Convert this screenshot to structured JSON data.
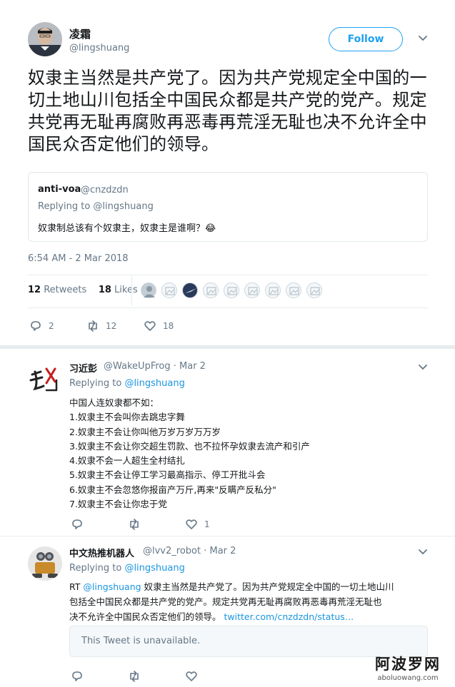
{
  "main_tweet": {
    "author_name": "凌霜",
    "author_handle": "@lingshuang",
    "follow_label": "Follow",
    "text": "奴隶主当然是共产党了。因为共产党规定全中国的一切土地山川包括全中国民众都是共产党的党产。规定共党再无耻再腐败再恶毒再荒淫无耻也决不允许全中国民众否定他们的领导。",
    "quote": {
      "name": "anti-voa",
      "handle": "@cnzdzdn",
      "replying": "Replying to @lingshuang",
      "text": "奴隶制总该有个奴隶主，奴隶主是谁啊？😂"
    },
    "timestamp": "6:54 AM - 2 Mar 2018",
    "retweets_count": "12",
    "retweets_label": "Retweets",
    "likes_count": "18",
    "likes_label": "Likes",
    "reply_count": "2",
    "retweet_count": "12",
    "like_count": "18"
  },
  "replies": [
    {
      "name": "习近彭",
      "handle_date": "@WakeUpFrog · Mar 2",
      "replying_prefix": "Replying to ",
      "replying_handle": "@lingshuang",
      "lines": [
        "中国人连奴隶都不如：",
        "1.奴隶主不会叫你去跳忠字舞",
        "2.奴隶主不会让你叫他万岁万岁万万岁",
        "3.奴隶主不会让你交超生罚款、也不拉怀孕奴隶去流产和引产",
        "4.奴隶不会一人超生全村结扎",
        "5.奴隶主不会让停工学习最高指示、停工开批斗会",
        "6.奴隶主不会忽悠你报亩产万斤,再来\"反瞒产反私分\"",
        "7.奴隶主不会让你忠于党"
      ],
      "reply_count": "",
      "retweet_count": "",
      "like_count": "1"
    },
    {
      "name": "中文热推机器人",
      "handle_date": "@lvv2_robot · Mar 2",
      "replying_prefix": "Replying to ",
      "replying_handle": "@lingshuang",
      "rt_prefix": "RT ",
      "rt_handle": "@lingshuang",
      "lines": [
        " 奴隶主当然是共产党了。因为共产党规定全中国的一切土地山川",
        "包括全中国民众都是共产党的党产。规定共党再无耻再腐败再恶毒再荒淫无耻也",
        "决不允许全中国民众否定他们的领导。 "
      ],
      "link": "twitter.com/cnzdzdn/status…",
      "unavailable": "This Tweet is unavailable."
    }
  ],
  "watermark": {
    "big": "阿波罗网",
    "small": "aboluowang.com"
  }
}
